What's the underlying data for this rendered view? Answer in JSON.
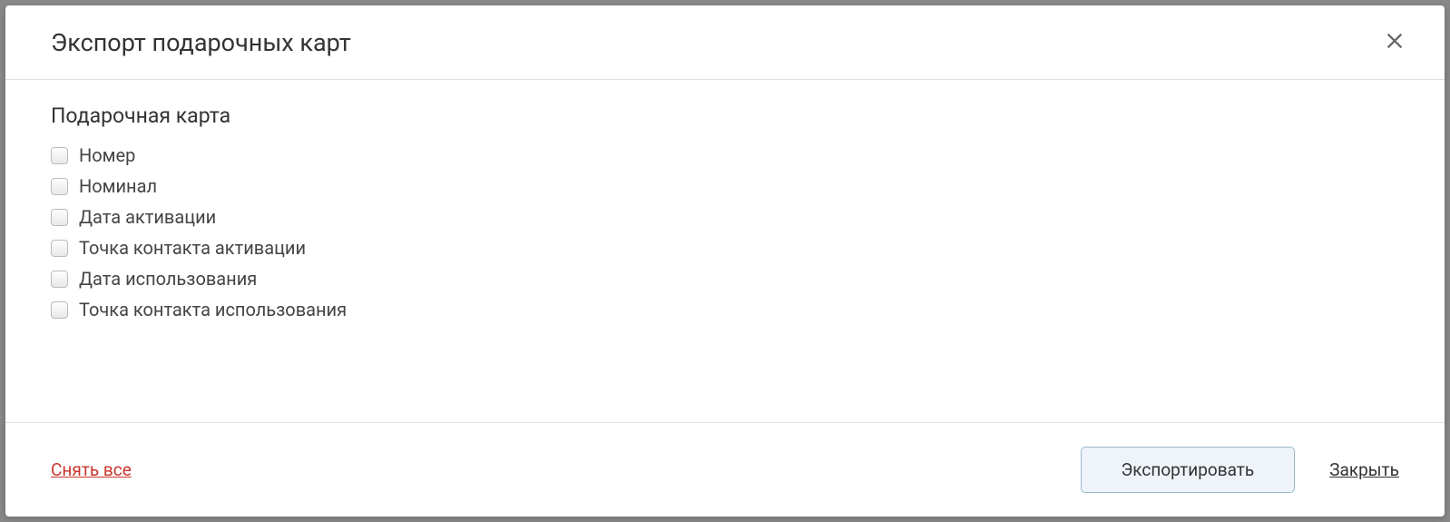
{
  "header": {
    "title": "Экспорт подарочных карт"
  },
  "body": {
    "section_title": "Подарочная карта",
    "checkboxes": [
      {
        "label": "Номер"
      },
      {
        "label": "Номинал"
      },
      {
        "label": "Дата активации"
      },
      {
        "label": "Точка контакта активации"
      },
      {
        "label": "Дата использования"
      },
      {
        "label": "Точка контакта использования"
      }
    ]
  },
  "footer": {
    "remove_all_label": "Снять все",
    "export_label": "Экспортировать",
    "close_label": "Закрыть"
  }
}
